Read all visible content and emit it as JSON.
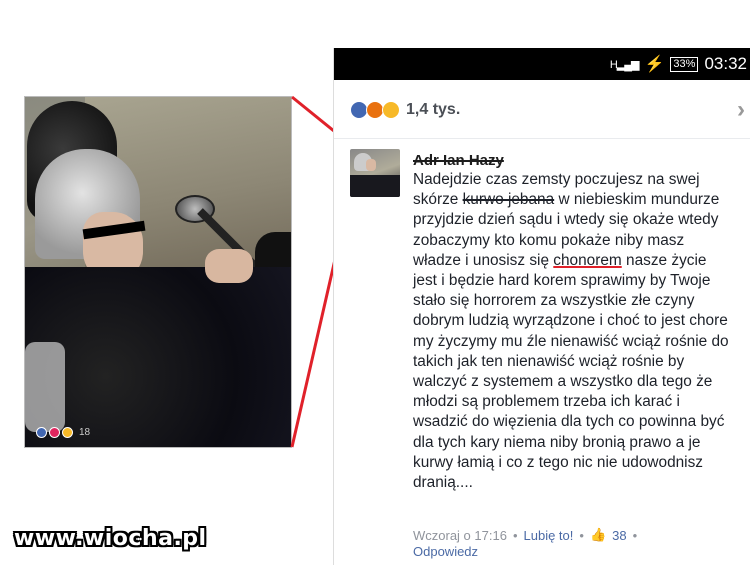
{
  "photo": {
    "reaction_count": "18",
    "colors": {
      "like": "#4267b2",
      "love": "#e0245e",
      "haha": "#f7b928"
    }
  },
  "status": {
    "signal_label": "H",
    "battery": "33%",
    "time": "03:32"
  },
  "reactions": {
    "count": "1,4 tys.",
    "icons": [
      "like-icon",
      "angry-icon",
      "sad-icon"
    ],
    "chevron": "›"
  },
  "comment": {
    "author": "Adr Ian Hazy",
    "text_before_strike": "Nadejdzie czas zemsty poczujesz na swej skórze ",
    "text_strike": "kurwo jebana",
    "text_mid": " w niebieskim mundurze przyjdzie dzień sądu i wtedy się okaże wtedy zobaczymy kto komu pokaże niby masz władze i unosisz się ",
    "text_underlined": "chonorem",
    "text_after": " nasze życie jest i będzie hard korem sprawimy by Twoje stało się horrorem za wszystkie złe czyny dobrym ludzią wyrządzone i choć to jest chore my życzymy mu źle nienawiść wciąż rośnie do takich jak ten nienawiść wciąż rośnie by walczyć z systemem a wszystko dla tego że młodzi są problemem trzeba ich karać i wsadzić do więzienia dla tych co powinna być dla tych kary niema niby bronią prawo a je kurwy łamią i co z tego nic nie udowodnisz dranią....",
    "timestamp": "Wczoraj o 17:16",
    "like_label": "Lubię to!",
    "like_count": "38",
    "reply_label": "Odpowiedz"
  },
  "watermark": "www.wiocha.pl"
}
